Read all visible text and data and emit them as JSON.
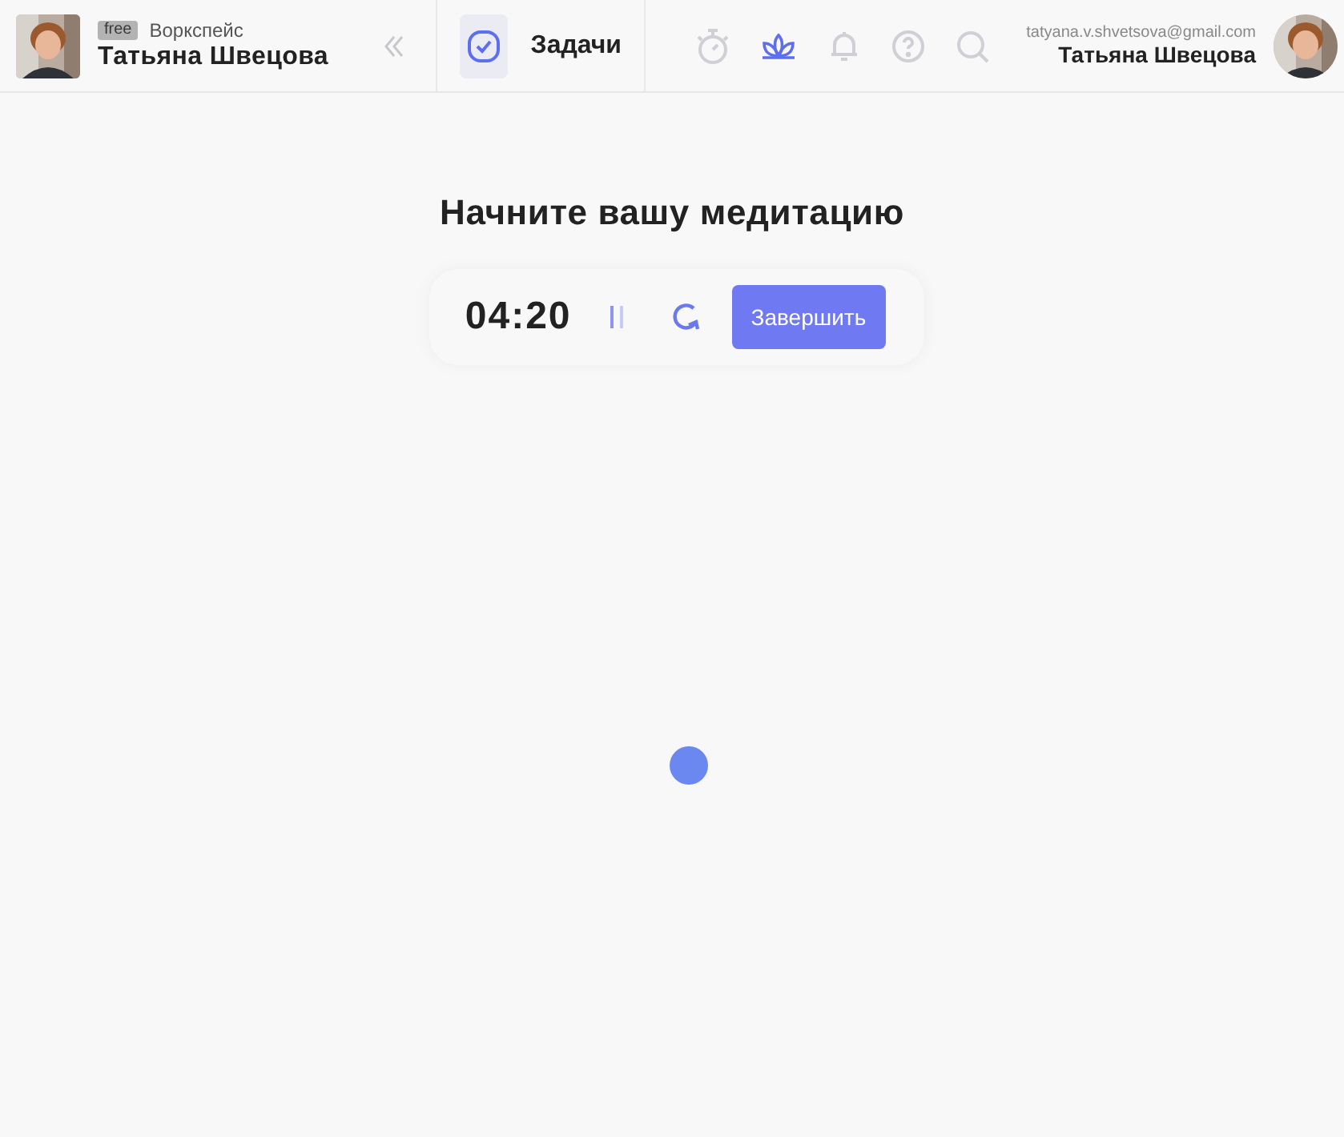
{
  "workspace": {
    "plan": "free",
    "label": "Воркспейс",
    "user": "Татьяна Швецова"
  },
  "section": {
    "label": "Задачи",
    "selected": true
  },
  "nav": [
    {
      "kind": "timer",
      "selected": false
    },
    {
      "kind": "lotus",
      "selected": true
    },
    {
      "kind": "bell",
      "selected": false
    },
    {
      "kind": "help",
      "selected": false
    },
    {
      "kind": "search",
      "selected": false
    }
  ],
  "account": {
    "email": "tatyana.v.shvetsova@gmail.com",
    "name": "Татьяна Швецова"
  },
  "meditation": {
    "title": "Начните вашу медитацию",
    "time": "04:20",
    "finish_button": "Завершить"
  }
}
